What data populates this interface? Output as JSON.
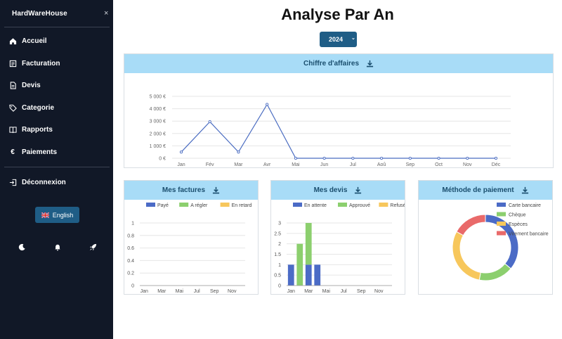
{
  "sidebar": {
    "brand": "HardWareHouse",
    "close_label": "×",
    "nav": [
      {
        "label": "Accueil",
        "icon": "home-icon"
      },
      {
        "label": "Facturation",
        "icon": "invoice-icon"
      },
      {
        "label": "Devis",
        "icon": "document-icon"
      },
      {
        "label": "Categorie",
        "icon": "tag-icon"
      },
      {
        "label": "Rapports",
        "icon": "book-icon"
      },
      {
        "label": "Paiements",
        "icon": "euro-icon"
      }
    ],
    "logout": {
      "label": "Déconnexion",
      "icon": "logout-icon"
    },
    "language": {
      "label": "English",
      "icon": "uk-flag-icon"
    },
    "bottom_icons": [
      "moon-icon",
      "bell-icon",
      "rocket-icon"
    ]
  },
  "page": {
    "title": "Analyse Par An",
    "year_value": "2024",
    "year_chevron": "⌄"
  },
  "colors": {
    "sidebar_bg": "#111827",
    "accent": "#1f5d86",
    "card_header": "#a8dcf7",
    "line": "#4a6cc1",
    "green": "#8ccf6e",
    "yellow": "#f7c75c",
    "red": "#e96a6a",
    "blue": "#4b6bc6"
  },
  "chart_data": [
    {
      "type": "line",
      "title": "Chiffre d'affaires",
      "categories": [
        "Jan",
        "Fév",
        "Mar",
        "Avr",
        "Mai",
        "Jun",
        "Jul",
        "Aoû",
        "Sep",
        "Oct",
        "Nov",
        "Déc"
      ],
      "values": [
        500,
        2950,
        500,
        4350,
        0,
        0,
        0,
        0,
        0,
        0,
        0,
        0
      ],
      "ytick_labels": [
        "0 €",
        "1 000 €",
        "2 000 €",
        "3 000 €",
        "4 000 €",
        "5 000 €"
      ],
      "ylim": [
        0,
        5000
      ]
    },
    {
      "type": "bar",
      "title": "Mes factures",
      "categories": [
        "Jan",
        "Mar",
        "Mai",
        "Jul",
        "Sep",
        "Nov"
      ],
      "legend": [
        "Payé",
        "A régler",
        "En retard"
      ],
      "ytick_labels": [
        "0",
        "0.2",
        "0.4",
        "0.6",
        "0.8",
        "1"
      ],
      "ylim": [
        0,
        1
      ],
      "series": []
    },
    {
      "type": "bar",
      "title": "Mes devis",
      "categories": [
        "Jan",
        "Fév",
        "Mar",
        "Avr",
        "Mai",
        "Jun",
        "Jul",
        "Aoû",
        "Sep",
        "Oct",
        "Nov",
        "Déc"
      ],
      "tick_labels": [
        "Jan",
        "Mar",
        "Mai",
        "Jul",
        "Sep",
        "Nov"
      ],
      "legend": [
        "En attente",
        "Approuvé",
        "Refusé"
      ],
      "ytick_labels": [
        "0",
        "0.5",
        "1",
        "1.5",
        "2",
        "2.5",
        "3"
      ],
      "ylim": [
        0,
        3
      ],
      "series": [
        {
          "name": "En attente",
          "values": [
            1,
            0,
            1,
            1,
            0,
            0,
            0,
            0,
            0,
            0,
            0,
            0
          ]
        },
        {
          "name": "Approuvé",
          "values": [
            0,
            2,
            2,
            0,
            0,
            0,
            0,
            0,
            0,
            0,
            0,
            0
          ]
        },
        {
          "name": "Refusé",
          "values": [
            0,
            0,
            0,
            0,
            0,
            0,
            0,
            0,
            0,
            0,
            0,
            0
          ]
        }
      ]
    },
    {
      "type": "pie",
      "title": "Méthode de paiement",
      "legend": [
        "Carte bancaire",
        "Chèque",
        "Espèces",
        "Virement bancaire"
      ],
      "values": [
        36,
        17,
        30,
        17
      ]
    }
  ]
}
